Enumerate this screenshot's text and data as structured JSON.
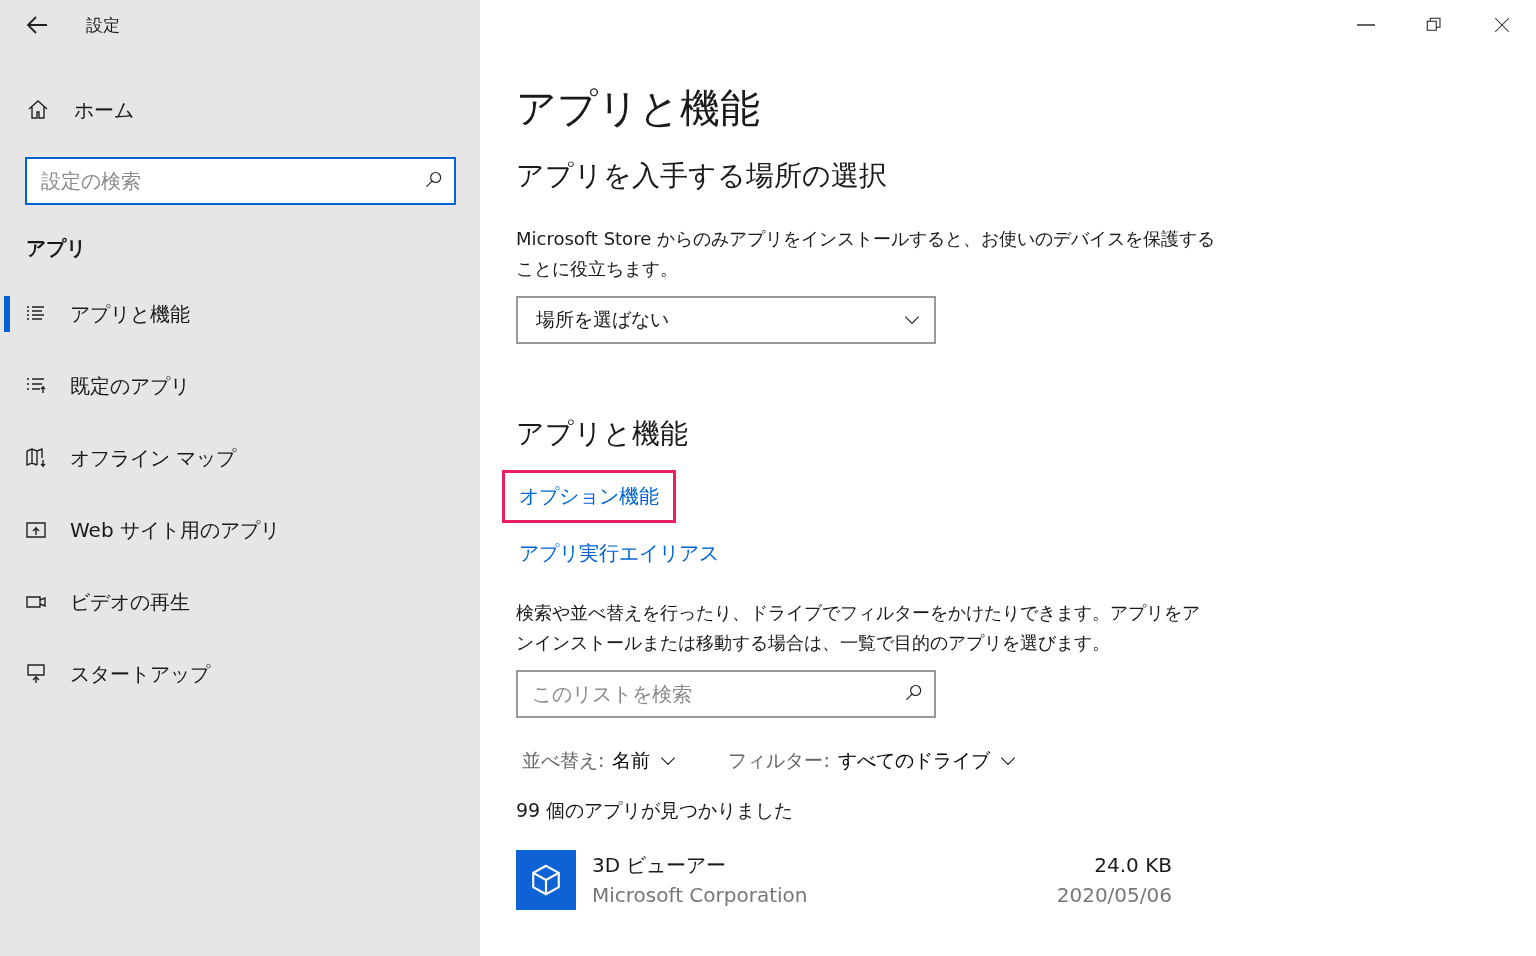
{
  "window": {
    "title": "設定"
  },
  "sidebar": {
    "home": "ホーム",
    "search": {
      "placeholder": "設定の検索",
      "focused": true
    },
    "section": "アプリ",
    "items": [
      {
        "label": "アプリと機能",
        "selected": true
      },
      {
        "label": "既定のアプリ",
        "selected": false
      },
      {
        "label": "オフライン マップ",
        "selected": false
      },
      {
        "label": "Web サイト用のアプリ",
        "selected": false
      },
      {
        "label": "ビデオの再生",
        "selected": false
      },
      {
        "label": "スタートアップ",
        "selected": false
      }
    ]
  },
  "main": {
    "title": "アプリと機能",
    "source_heading": "アプリを入手する場所の選択",
    "source_description": "Microsoft Store からのみアプリをインストールすると、お使いのデバイスを保護することに役立ちます。",
    "source_dropdown": "場所を選ばない",
    "apps_heading": "アプリと機能",
    "links": [
      {
        "label": "オプション機能",
        "highlighted": true
      },
      {
        "label": "アプリ実行エイリアス",
        "highlighted": false
      }
    ],
    "apps_description": "検索や並べ替えを行ったり、ドライブでフィルターをかけたりできます。アプリをアンインストールまたは移動する場合は、一覧で目的のアプリを選びます。",
    "list_search": {
      "placeholder": "このリストを検索"
    },
    "sort": {
      "label": "並べ替え:",
      "value": "名前"
    },
    "filter": {
      "label": "フィルター:",
      "value": "すべてのドライブ"
    },
    "count": "99 個のアプリが見つかりました",
    "apps": [
      {
        "name": "3D ビューアー",
        "publisher": "Microsoft Corporation",
        "size": "24.0 KB",
        "date": "2020/05/06"
      }
    ]
  }
}
